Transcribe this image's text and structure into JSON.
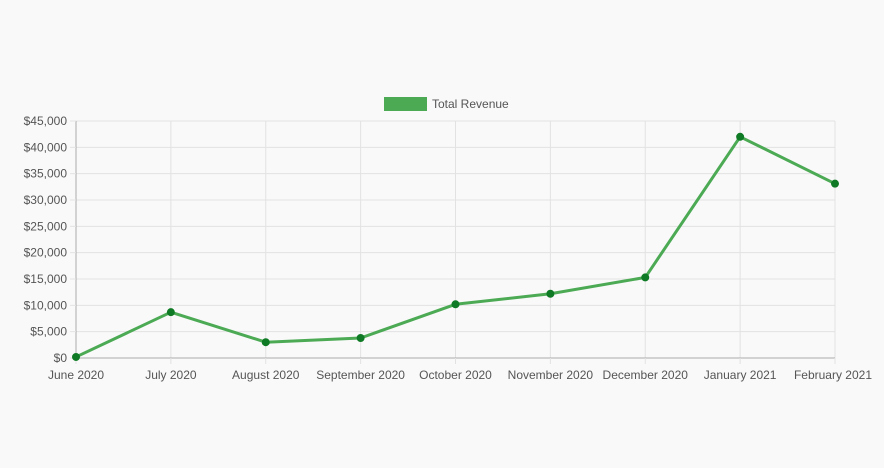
{
  "chart_data": {
    "type": "line",
    "title": "",
    "xlabel": "",
    "ylabel": "",
    "categories": [
      "June 2020",
      "July 2020",
      "August 2020",
      "September 2020",
      "October 2020",
      "November 2020",
      "December 2020",
      "January 2021",
      "February 2021"
    ],
    "series": [
      {
        "name": "Total Revenue",
        "values": [
          200,
          8700,
          3000,
          3800,
          10200,
          12200,
          15300,
          42000,
          33100
        ]
      }
    ],
    "ylim": [
      0,
      45000
    ],
    "y_ticks": [
      0,
      5000,
      10000,
      15000,
      20000,
      25000,
      30000,
      35000,
      40000,
      45000
    ],
    "y_tick_labels": [
      "$0",
      "$5,000",
      "$10,000",
      "$15,000",
      "$20,000",
      "$25,000",
      "$30,000",
      "$35,000",
      "$40,000",
      "$45,000"
    ],
    "grid": true,
    "legend_position": "top-center",
    "colors": {
      "line": "#4caa55",
      "point": "#0f7a25",
      "legend_swatch": "#4caa55",
      "grid": "#e2e2e2",
      "axis": "#aaaaaa",
      "text": "#555555"
    }
  }
}
